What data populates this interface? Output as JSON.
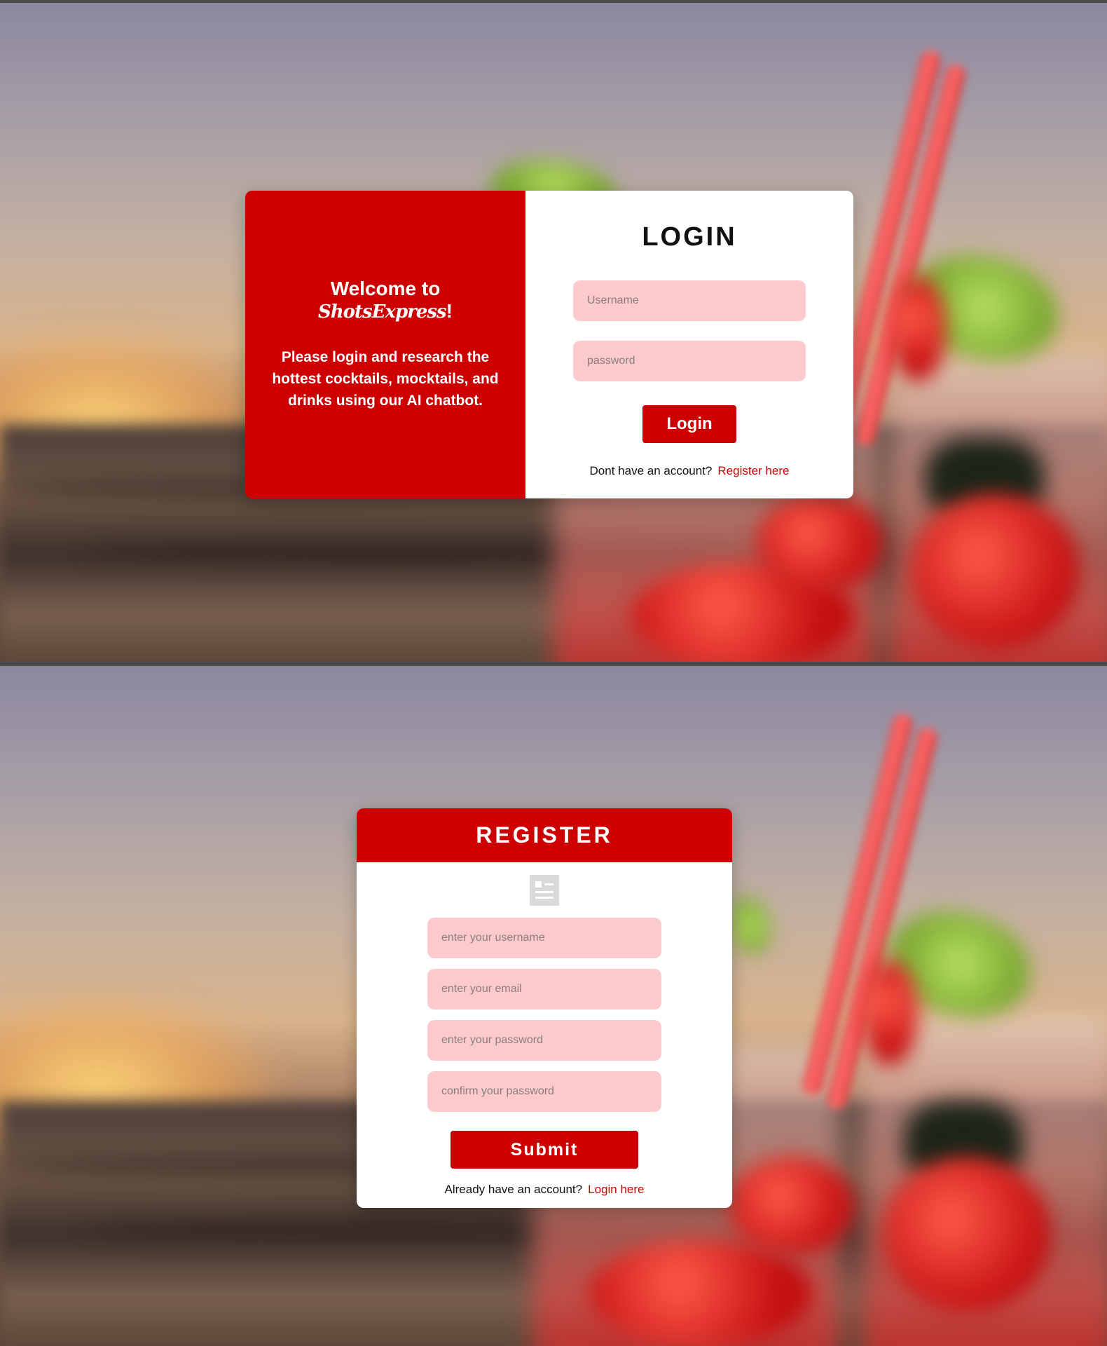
{
  "login": {
    "title": "LOGIN",
    "welcome_prefix": "Welcome to ",
    "brand": "ShotsExpress",
    "welcome_suffix": "!",
    "message": "Please login and research the hottest cocktails, mocktails, and drinks using our AI chatbot.",
    "username_placeholder": "Username",
    "password_placeholder": "password",
    "button_label": "Login",
    "switch_text": "Dont have an account?",
    "switch_link": "Register here"
  },
  "register": {
    "title": "REGISTER",
    "icon": "form-icon",
    "username_placeholder": "enter your username",
    "email_placeholder": "enter your email",
    "password_placeholder": "enter your password",
    "confirm_placeholder": "confirm your password",
    "button_label": "Submit",
    "switch_text": "Already have an account?",
    "switch_link": "Login here"
  },
  "colors": {
    "accent": "#cc0000",
    "input_bg": "#fccacc",
    "card_bg": "#ffffff"
  }
}
